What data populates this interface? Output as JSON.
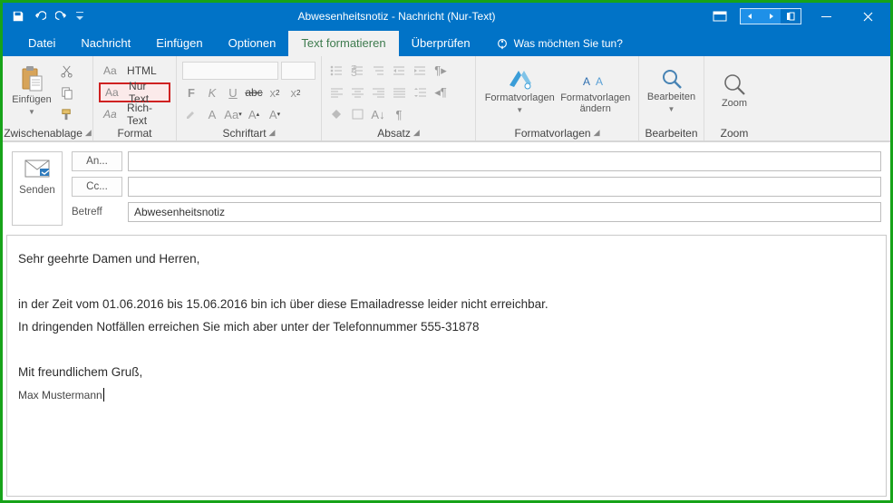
{
  "titlebar": {
    "title": "Abwesenheitsnotiz - Nachricht (Nur-Text)"
  },
  "tabs": {
    "datei": "Datei",
    "nachricht": "Nachricht",
    "einfuegen": "Einfügen",
    "optionen": "Optionen",
    "textformat": "Text formatieren",
    "ueberpruefen": "Überprüfen",
    "tell": "Was möchten Sie tun?"
  },
  "ribbon": {
    "clipboard": {
      "paste": "Einfügen",
      "label": "Zwischenablage"
    },
    "format": {
      "html": "HTML",
      "plain": "Nur Text",
      "rich": "Rich-Text",
      "label": "Format",
      "aa": "Aa"
    },
    "font": {
      "label": "Schriftart"
    },
    "para": {
      "label": "Absatz"
    },
    "styles": {
      "templates": "Formatvorlagen",
      "change": "Formatvorlagen ändern",
      "label": "Formatvorlagen"
    },
    "edit": {
      "label": "Bearbeiten",
      "btn": "Bearbeiten"
    },
    "zoom": {
      "label": "Zoom",
      "btn": "Zoom"
    }
  },
  "compose": {
    "send": "Senden",
    "to": "An...",
    "cc": "Cc...",
    "subjectLabel": "Betreff",
    "subject": "Abwesenheitsnotiz"
  },
  "body": {
    "l1": "Sehr geehrte Damen und Herren,",
    "l2": "in der Zeit vom 01.06.2016 bis 15.06.2016 bin ich über diese Emailadresse leider nicht erreichbar.",
    "l3": "In dringenden Notfällen erreichen Sie mich aber unter der Telefonnummer 555-31878",
    "l4": "Mit freundlichem Gruß,",
    "l5": "Max Mustermann"
  }
}
